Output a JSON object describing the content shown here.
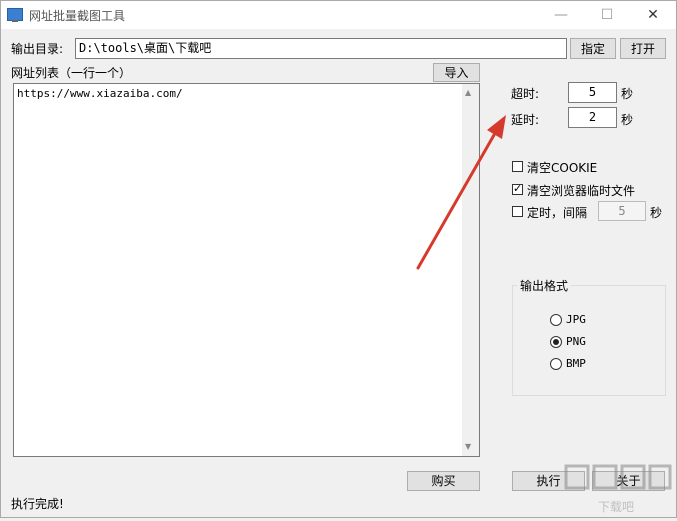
{
  "window": {
    "title": "网址批量截图工具",
    "minimize": "—",
    "maximize": "☐",
    "close": "✕"
  },
  "output_dir": {
    "label": "输出目录:",
    "value": "D:\\tools\\桌面\\下载吧",
    "specify_button": "指定",
    "open_button": "打开"
  },
  "url_list": {
    "label": "网址列表（一行一个）",
    "import_button": "导入",
    "content": "https://www.xiazaiba.com/"
  },
  "timeout": {
    "label": "超时:",
    "value": "5",
    "unit": "秒"
  },
  "delay": {
    "label": "延时:",
    "value": "2",
    "unit": "秒"
  },
  "options": {
    "clear_cookie": {
      "label": "清空COOKIE",
      "checked": false
    },
    "clear_temp": {
      "label": "清空浏览器临时文件",
      "checked": true
    },
    "timer": {
      "label": "定时，间隔",
      "checked": false,
      "value": "5",
      "unit": "秒"
    }
  },
  "output_format": {
    "title": "输出格式",
    "options": [
      {
        "label": "JPG",
        "selected": false
      },
      {
        "label": "PNG",
        "selected": true
      },
      {
        "label": "BMP",
        "selected": false
      }
    ]
  },
  "buttons": {
    "buy": "购买",
    "execute": "执行",
    "about": "关于"
  },
  "status": {
    "text": "执行完成!"
  },
  "watermark": {
    "text": "下载吧",
    "color": "#b0b0b0"
  },
  "annotation": {
    "arrow_color": "#d63a2c"
  }
}
